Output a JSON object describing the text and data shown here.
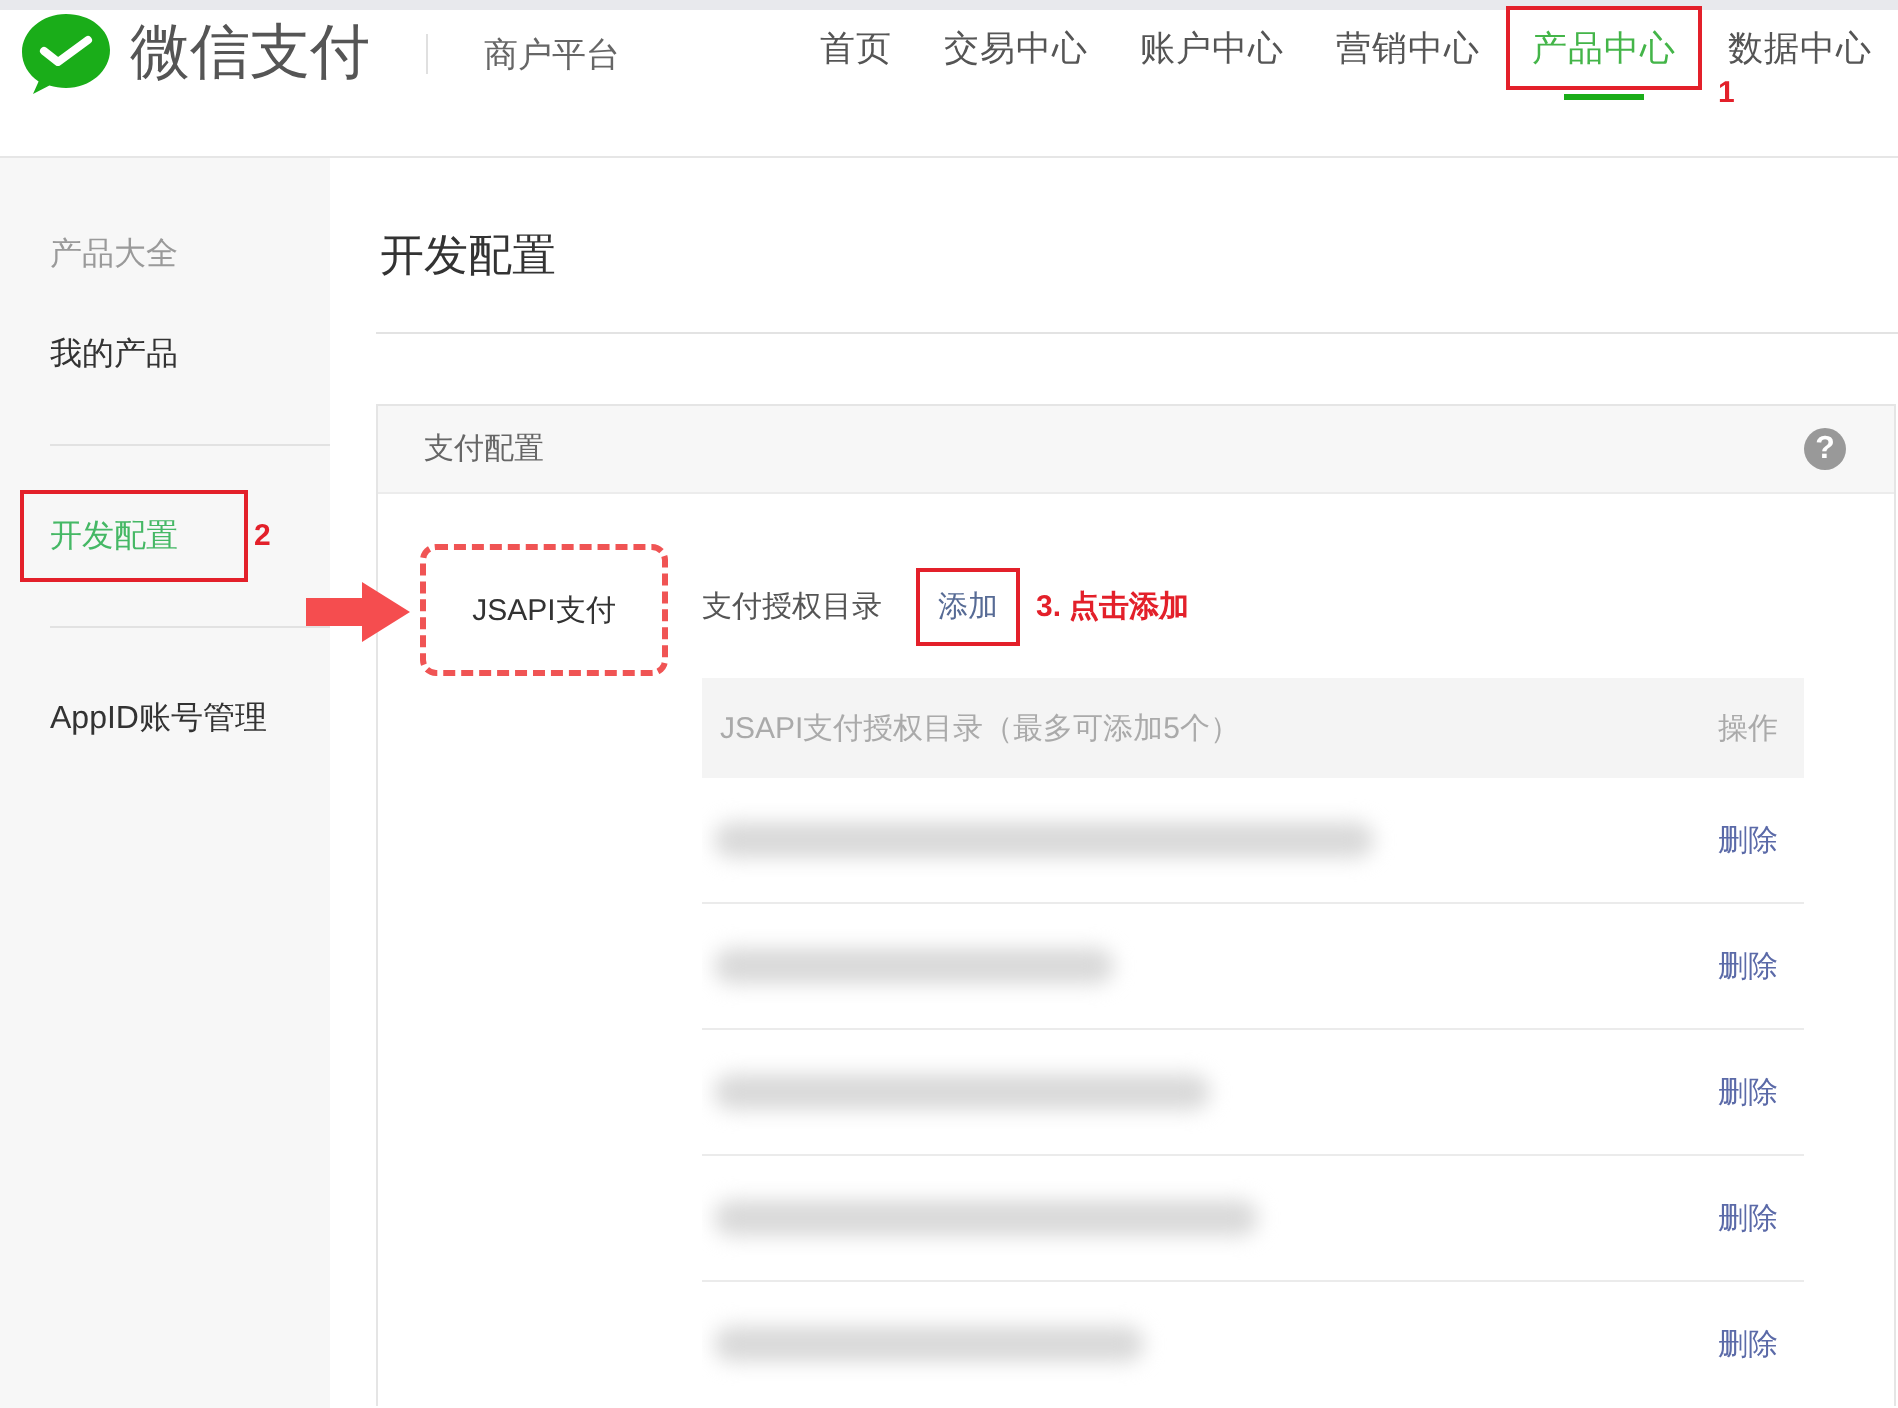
{
  "header": {
    "brand": "微信支付",
    "subtitle": "商户平台",
    "nav": [
      {
        "label": "首页",
        "selected": false,
        "highlighted": false
      },
      {
        "label": "交易中心",
        "selected": false,
        "highlighted": false
      },
      {
        "label": "账户中心",
        "selected": false,
        "highlighted": false
      },
      {
        "label": "营销中心",
        "selected": false,
        "highlighted": false
      },
      {
        "label": "产品中心",
        "selected": true,
        "highlighted": true,
        "annotation": "1"
      },
      {
        "label": "数据中心",
        "selected": false,
        "highlighted": false
      }
    ]
  },
  "sidebar": {
    "groups": [
      [
        {
          "label": "产品大全",
          "kind": "heading",
          "selected": false,
          "highlighted": false
        },
        {
          "label": "我的产品",
          "kind": "link",
          "selected": false,
          "highlighted": false
        }
      ],
      [
        {
          "label": "开发配置",
          "kind": "link",
          "selected": true,
          "highlighted": true,
          "annotation": "2"
        }
      ],
      [
        {
          "label": "AppID账号管理",
          "kind": "link",
          "selected": false,
          "highlighted": false
        }
      ]
    ]
  },
  "page": {
    "title": "开发配置",
    "panel": {
      "title": "支付配置",
      "help": "?",
      "tabs": [
        {
          "label": "JSAPI支付",
          "selected": true,
          "highlighted": true
        }
      ],
      "section_label": "支付授权目录",
      "add_link": {
        "label": "添加",
        "highlighted": true,
        "annotation": "3. 点击添加"
      },
      "table": {
        "columns": [
          "JSAPI支付授权目录（最多可添加5个）",
          "操作"
        ],
        "rows": [
          {
            "redacted": true,
            "action": "删除"
          },
          {
            "redacted": true,
            "action": "删除"
          },
          {
            "redacted": true,
            "action": "删除"
          },
          {
            "redacted": true,
            "action": "删除"
          },
          {
            "redacted": true,
            "action": "删除"
          }
        ]
      }
    }
  }
}
